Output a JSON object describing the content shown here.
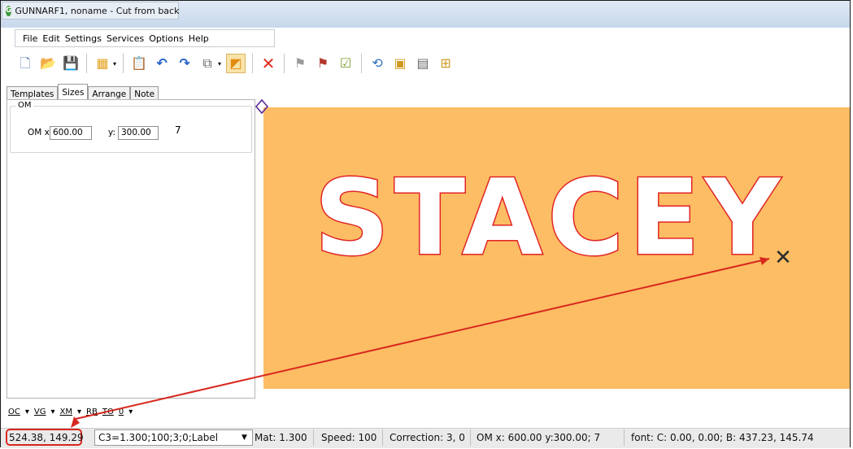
{
  "window": {
    "title": "GUNNARF1,   noname - Cut from back"
  },
  "menu": [
    "File",
    "Edit",
    "Settings",
    "Services",
    "Options",
    "Help"
  ],
  "toolbar": {
    "buttons": [
      {
        "name": "new-file-icon",
        "glyph": "🗋"
      },
      {
        "name": "open-folder-icon",
        "glyph": "📂"
      },
      {
        "name": "save-icon",
        "glyph": "💾"
      },
      {
        "name": "grid-template-icon",
        "glyph": "▦"
      },
      {
        "name": "paste-icon",
        "glyph": "📋"
      },
      {
        "name": "undo-icon",
        "glyph": "↶"
      },
      {
        "name": "redo-icon",
        "glyph": "↷"
      },
      {
        "name": "copy-icon",
        "glyph": "⧉"
      },
      {
        "name": "cut-direction-icon",
        "glyph": "◩"
      },
      {
        "name": "delete-icon",
        "glyph": "✕"
      },
      {
        "name": "flag-gray-icon",
        "glyph": "⚑"
      },
      {
        "name": "flag-check-icon",
        "glyph": "⚑"
      },
      {
        "name": "checkbox-icon",
        "glyph": "☑"
      },
      {
        "name": "rotate-icon",
        "glyph": "⟲"
      },
      {
        "name": "label-icon",
        "glyph": "▣"
      },
      {
        "name": "grid-icon",
        "glyph": "▤"
      },
      {
        "name": "layout-icon",
        "glyph": "⊞"
      }
    ]
  },
  "tabs": [
    "Templates",
    "Sizes",
    "Arrange",
    "Note"
  ],
  "active_tab": "Sizes",
  "om_group": {
    "legend": "OM",
    "x_label": "OM x",
    "x_value": "600.00",
    "y_label": "y:",
    "y_value": "300.00",
    "extra_value": "7"
  },
  "bottom_tools": [
    "OC",
    "VG",
    "XM",
    "RB",
    "TO",
    "0"
  ],
  "canvas": {
    "text": "STACEY",
    "background": "#fdbd64",
    "outline": "#e02424",
    "marker": "✕"
  },
  "status": {
    "coords": "524.38, 149.29",
    "c3": "C3=1.300;100;3;0;Label",
    "mat": "Mat: 1.300",
    "speed": "Speed: 100",
    "correction": "Correction: 3, 0",
    "om": "OM x: 600.00 y:300.00; 7",
    "font": "font: C: 0.00, 0.00; B: 437.23, 145.74"
  },
  "colors": {
    "annotation_red": "#d8271f",
    "canvas_orange": "#fdbd64",
    "title_blue": "#c7d8ec"
  }
}
